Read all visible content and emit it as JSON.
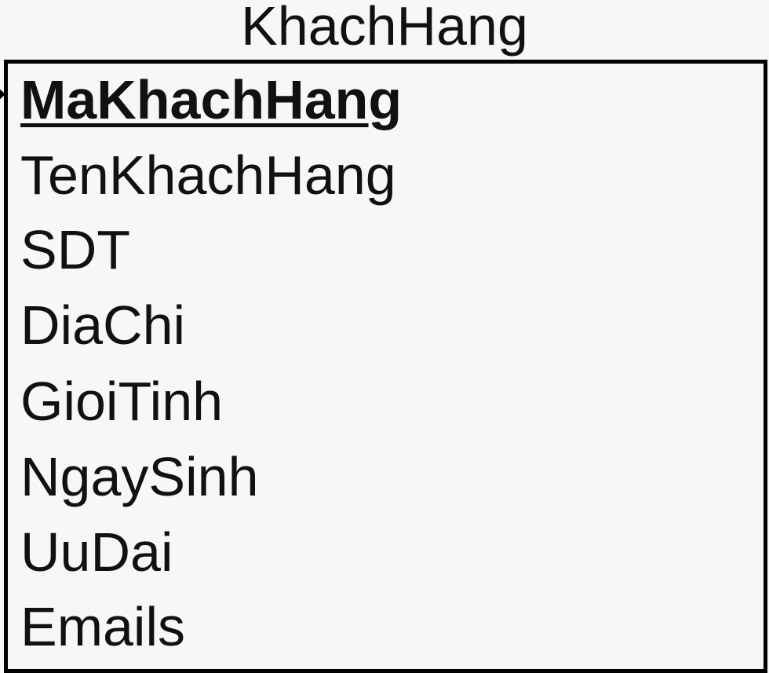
{
  "entity": {
    "name": "KhachHang",
    "attributes": [
      {
        "label": "MaKhachHang",
        "primary_key": true
      },
      {
        "label": "TenKhachHang",
        "primary_key": false
      },
      {
        "label": "SDT",
        "primary_key": false
      },
      {
        "label": "DiaChi",
        "primary_key": false
      },
      {
        "label": "GioiTinh",
        "primary_key": false
      },
      {
        "label": "NgaySinh",
        "primary_key": false
      },
      {
        "label": "UuDai",
        "primary_key": false
      },
      {
        "label": "Emails",
        "primary_key": false
      }
    ]
  },
  "colors": {
    "background": "#f7f7f7",
    "border": "#000000",
    "text": "#111111"
  }
}
